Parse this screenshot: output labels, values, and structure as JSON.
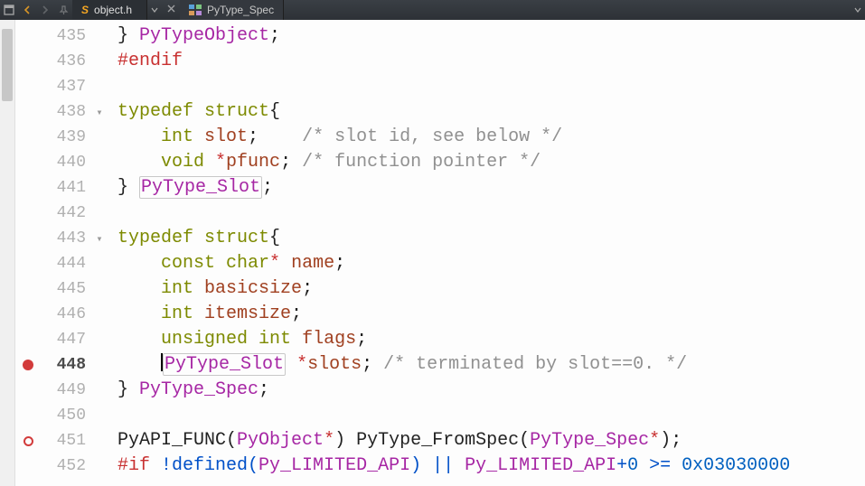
{
  "titlebar": {
    "tab1_label": "object.h",
    "tab2_label": "PyType_Spec"
  },
  "gutter": {
    "lines": [
      {
        "n": "435",
        "fold": "",
        "marker": ""
      },
      {
        "n": "436",
        "fold": "",
        "marker": ""
      },
      {
        "n": "437",
        "fold": "",
        "marker": ""
      },
      {
        "n": "438",
        "fold": "▾",
        "marker": ""
      },
      {
        "n": "439",
        "fold": "",
        "marker": ""
      },
      {
        "n": "440",
        "fold": "",
        "marker": ""
      },
      {
        "n": "441",
        "fold": "",
        "marker": ""
      },
      {
        "n": "442",
        "fold": "",
        "marker": ""
      },
      {
        "n": "443",
        "fold": "▾",
        "marker": ""
      },
      {
        "n": "444",
        "fold": "",
        "marker": ""
      },
      {
        "n": "445",
        "fold": "",
        "marker": ""
      },
      {
        "n": "446",
        "fold": "",
        "marker": ""
      },
      {
        "n": "447",
        "fold": "",
        "marker": ""
      },
      {
        "n": "448",
        "fold": "",
        "marker": "err",
        "current": true
      },
      {
        "n": "449",
        "fold": "",
        "marker": ""
      },
      {
        "n": "450",
        "fold": "",
        "marker": ""
      },
      {
        "n": "451",
        "fold": "",
        "marker": "circ"
      },
      {
        "n": "452",
        "fold": "",
        "marker": ""
      }
    ]
  },
  "code": {
    "l435": {
      "brace": "} ",
      "type": "PyTypeObject",
      "semi": ";"
    },
    "l436": {
      "pp": "#endif"
    },
    "l438": {
      "kw1": "typedef ",
      "kw2": "struct",
      "brace": "{"
    },
    "l439": {
      "indent": "    ",
      "kw": "int ",
      "ident": "slot",
      "semi": ";",
      "pad": "    ",
      "comment": "/* slot id, see below */"
    },
    "l440": {
      "indent": "    ",
      "kw": "void ",
      "op": "*",
      "ident": "pfunc",
      "semi": ";",
      "pad": " ",
      "comment": "/* function pointer */"
    },
    "l441": {
      "brace": "} ",
      "type": "PyType_Slot",
      "semi": ";"
    },
    "l443": {
      "kw1": "typedef ",
      "kw2": "struct",
      "brace": "{"
    },
    "l444": {
      "indent": "    ",
      "kw": "const ",
      "kw2": "char",
      "op": "* ",
      "ident": "name",
      "semi": ";"
    },
    "l445": {
      "indent": "    ",
      "kw": "int ",
      "ident": "basicsize",
      "semi": ";"
    },
    "l446": {
      "indent": "    ",
      "kw": "int ",
      "ident": "itemsize",
      "semi": ";"
    },
    "l447": {
      "indent": "    ",
      "kw": "unsigned ",
      "kw2": "int ",
      "ident": "flags",
      "semi": ";"
    },
    "l448": {
      "indent": "    ",
      "type": "PyType_Slot",
      "sp": " ",
      "op": "*",
      "ident": "slots",
      "semi": ";",
      "pad": " ",
      "comment": "/* terminated by slot==0. */"
    },
    "l449": {
      "brace": "} ",
      "type": "PyType_Spec",
      "semi": ";"
    },
    "l451": {
      "func": "PyAPI_FUNC",
      "p1": "(",
      "type": "PyObject",
      "op": "*",
      "p2": ") ",
      "func2": "PyType_FromSpec",
      "p3": "(",
      "type2": "PyType_Spec",
      "op2": "*",
      "p4": ");"
    },
    "l452": {
      "pp": "#if ",
      "body": "!defined(",
      "mac": "Py_LIMITED_API",
      "body2": ") || ",
      "mac2": "Py_LIMITED_API",
      "body3": "+",
      "num": "0",
      "body4": " >= ",
      "num2": "0x03030000"
    }
  }
}
